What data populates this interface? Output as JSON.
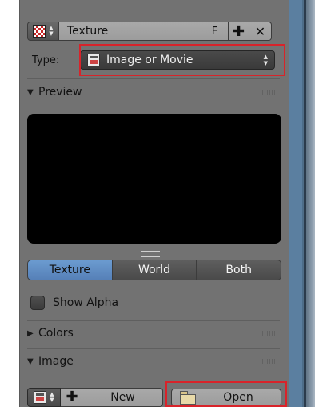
{
  "texture_block": {
    "name": "Texture",
    "fake_user_label": "F",
    "add_symbol": "✚",
    "remove_symbol": "✕",
    "icon": "checker-texture-icon"
  },
  "type_row": {
    "label": "Type:",
    "selected": "Image or Movie",
    "icon": "image-movie-icon"
  },
  "preview_section": {
    "title": "Preview",
    "tabs": [
      "Texture",
      "World",
      "Both"
    ],
    "active_tab": "Texture",
    "show_alpha_label": "Show Alpha"
  },
  "colors_section": {
    "title": "Colors"
  },
  "image_section": {
    "title": "Image",
    "new_label": "New",
    "new_symbol": "✚",
    "open_label": "Open"
  },
  "colors": {
    "panel": "#727272",
    "active_tab": "#5e8cc4",
    "highlight": "#d8232a"
  }
}
